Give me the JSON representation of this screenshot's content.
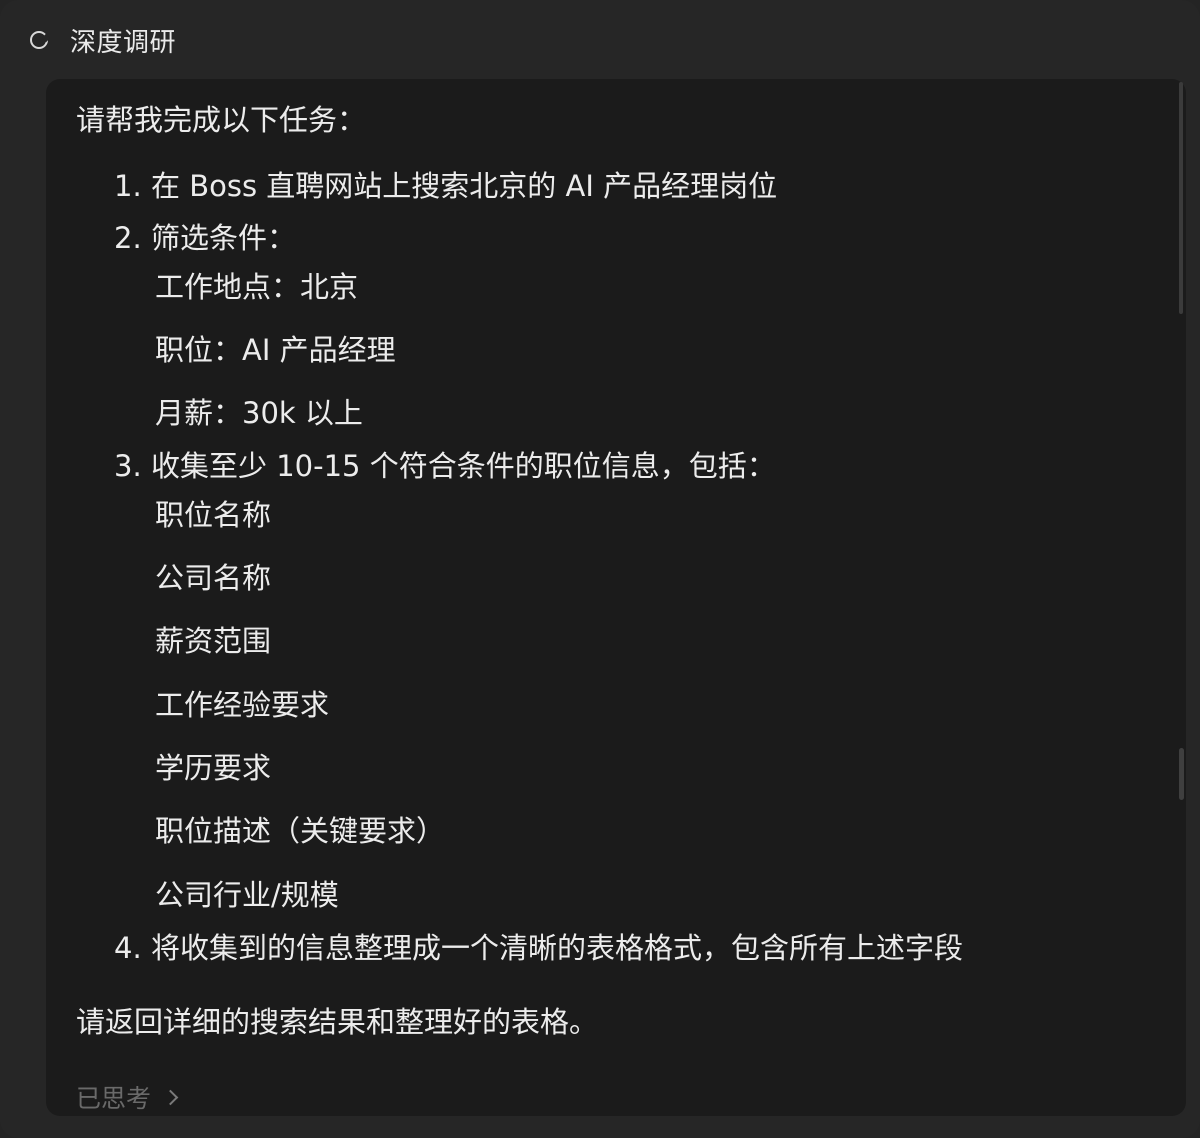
{
  "header": {
    "title": "深度调研",
    "status_icon": "loading-spinner-icon"
  },
  "message": {
    "intro": "请帮我完成以下任务：",
    "items": [
      {
        "num": "1.",
        "text": "在 Boss 直聘网站上搜索北京的 AI 产品经理岗位"
      },
      {
        "num": "2.",
        "text": "筛选条件：",
        "subs": [
          "工作地点：北京",
          "职位：AI 产品经理",
          "月薪：30k 以上"
        ]
      },
      {
        "num": "3.",
        "text": "收集至少 10-15 个符合条件的职位信息，包括：",
        "subs": [
          "职位名称",
          "公司名称",
          "薪资范围",
          "工作经验要求",
          "学历要求",
          "职位描述（关键要求）",
          "公司行业/规模"
        ]
      },
      {
        "num": "4.",
        "text": "将收集到的信息整理成一个清晰的表格格式，包含所有上述字段"
      }
    ],
    "closing": "请返回详细的搜索结果和整理好的表格。"
  },
  "footer": {
    "thought_label": "已思考",
    "thought_icon": "chevron-right-icon"
  }
}
